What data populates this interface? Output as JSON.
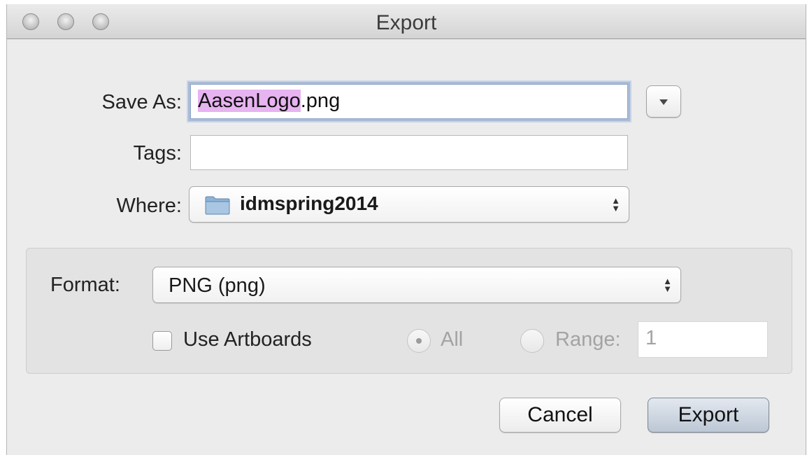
{
  "window": {
    "title": "Export"
  },
  "form": {
    "save_as_label": "Save As:",
    "filename_selected": "AasenLogo",
    "filename_extension": ".png",
    "tags_label": "Tags:",
    "tags_value": "",
    "where_label": "Where:",
    "where_value": "idmspring2014"
  },
  "options": {
    "format_label": "Format:",
    "format_value": "PNG (png)",
    "use_artboards_label": "Use Artboards",
    "use_artboards_checked": false,
    "all_label": "All",
    "range_label": "Range:",
    "range_value": "1"
  },
  "buttons": {
    "cancel_label": "Cancel",
    "export_label": "Export"
  },
  "colors": {
    "selection_highlight": "#e7b3f0",
    "window_background": "#ececec",
    "default_button": "#bcc7d5"
  }
}
